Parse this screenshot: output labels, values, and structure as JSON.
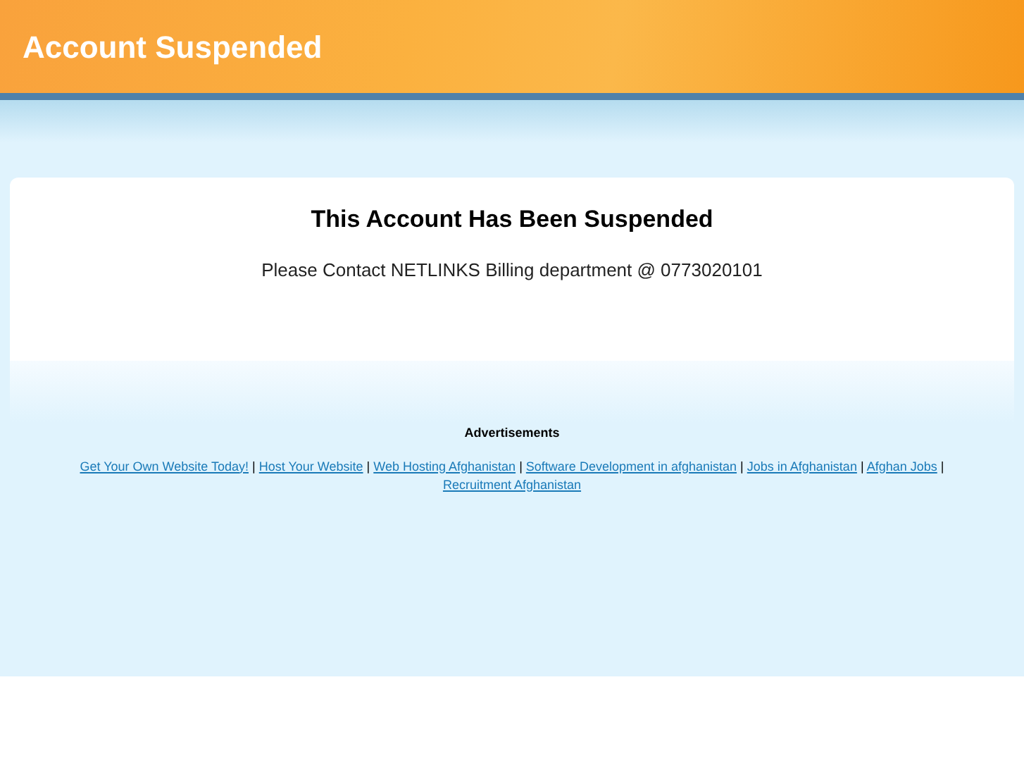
{
  "header": {
    "title": "Account Suspended"
  },
  "notice": {
    "heading": "This Account Has Been Suspended",
    "message": "Please Contact NETLINKS Billing department @ 0773020101"
  },
  "ads": {
    "heading": "Advertisements",
    "separator": "|",
    "links": [
      "Get Your Own Website Today!",
      "Host Your Website",
      "Web Hosting Afghanistan",
      "Software Development in afghanistan",
      "Jobs in Afghanistan",
      "Afghan Jobs",
      "Recruitment Afghanistan"
    ]
  }
}
